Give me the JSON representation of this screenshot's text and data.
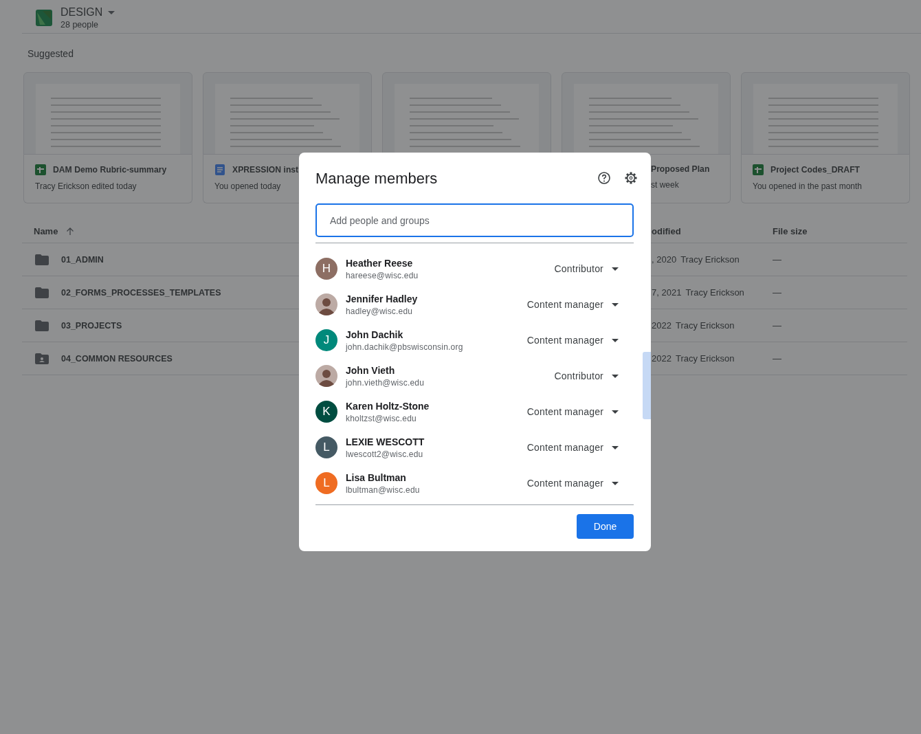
{
  "header": {
    "title": "DESIGN",
    "subtitle": "28 people"
  },
  "suggested": {
    "heading": "Suggested",
    "cards": [
      {
        "kind": "sheet",
        "title": "DAM Demo Rubric-summary",
        "subtitle": "Tracy Erickson edited today"
      },
      {
        "kind": "doc",
        "title": "XPRESSION inst",
        "subtitle": "You opened today"
      },
      {
        "kind": "covered"
      },
      {
        "kind": "covered",
        "title": "Proposed Plan",
        "subtitle": "st week"
      },
      {
        "kind": "sheet",
        "title": "Project Codes_DRAFT",
        "subtitle": "You opened in the past month"
      }
    ]
  },
  "table": {
    "columns": [
      "Name",
      "odified",
      "File size"
    ],
    "rows": [
      {
        "kind": "folder",
        "name": "01_ADMIN",
        "modified": ", 2020",
        "owner": "Tracy Erickson",
        "size": "—"
      },
      {
        "kind": "folder",
        "name": "02_FORMS_PROCESSES_TEMPLATES",
        "modified": "7, 2021",
        "owner": "Tracy Erickson",
        "size": "—"
      },
      {
        "kind": "folder",
        "name": "03_PROJECTS",
        "modified": "2022",
        "owner": "Tracy Erickson",
        "size": "—"
      },
      {
        "kind": "shared-folder",
        "name": "04_COMMON RESOURCES",
        "modified": "2022",
        "owner": "Tracy Erickson",
        "size": "—"
      }
    ]
  },
  "dialog": {
    "title": "Manage members",
    "search": {
      "placeholder": "Add people and groups"
    },
    "members": [
      {
        "kind": "letter",
        "initial": "H",
        "color": "#8d6e63",
        "name": "Heather Reese",
        "email": "hareese@wisc.edu",
        "role": "Contributor"
      },
      {
        "kind": "photo",
        "name": "Jennifer Hadley",
        "email": "hadley@wisc.edu",
        "role": "Content manager"
      },
      {
        "kind": "letter",
        "initial": "J",
        "color": "#00897b",
        "name": "John Dachik",
        "email": "john.dachik@pbswisconsin.org",
        "role": "Content manager"
      },
      {
        "kind": "photo",
        "name": "John Vieth",
        "email": "john.vieth@wisc.edu",
        "role": "Contributor"
      },
      {
        "kind": "letter",
        "initial": "K",
        "color": "#004d40",
        "name": "Karen Holtz-Stone",
        "email": "kholtzst@wisc.edu",
        "role": "Content manager"
      },
      {
        "kind": "letter",
        "initial": "L",
        "color": "#455a64",
        "name": "LEXIE WESCOTT",
        "email": "lwescott2@wisc.edu",
        "role": "Content manager"
      },
      {
        "kind": "letter",
        "initial": "L",
        "color": "#ef6c22",
        "name": "Lisa Bultman",
        "email": "lbultman@wisc.edu",
        "role": "Content manager"
      }
    ],
    "done": "Done"
  }
}
